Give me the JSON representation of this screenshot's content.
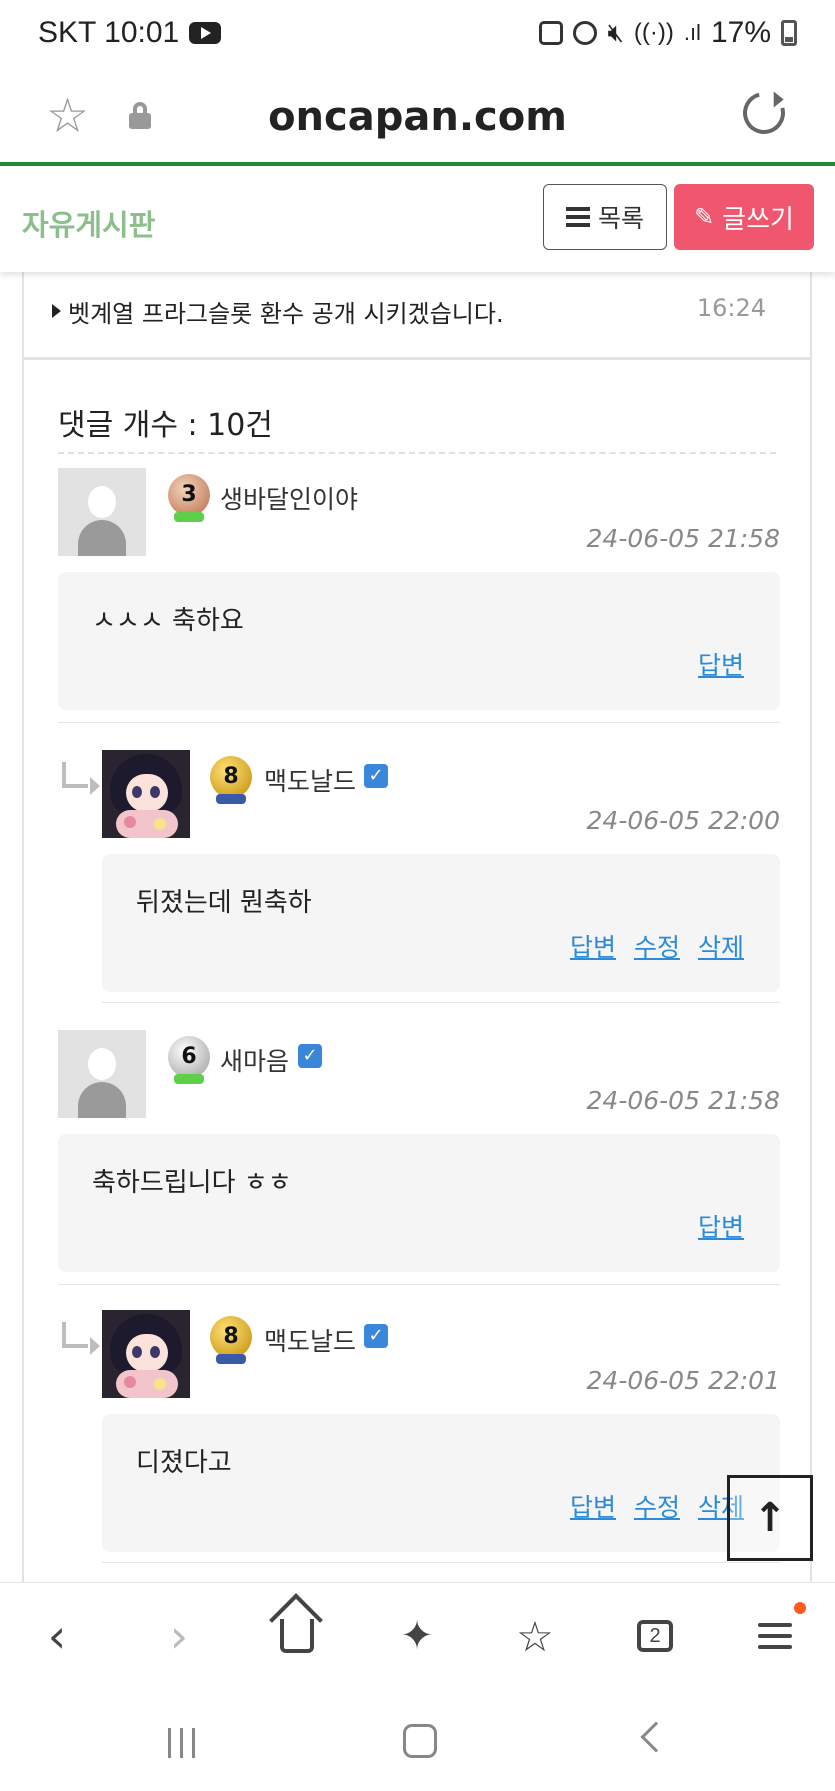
{
  "status_bar": {
    "carrier_time": "SKT 10:01",
    "battery": "17%"
  },
  "browser": {
    "url": "oncapan.com"
  },
  "board": {
    "title": "자유게시판",
    "list_button": "목록",
    "write_button": "글쓰기"
  },
  "prev_post": {
    "title": "벳계열 프라그슬롯 환수 공개 시키겠습니다.",
    "time": "16:24"
  },
  "comments_header": "댓글 개수 : 10건",
  "comments": [
    {
      "nickname": "생바달인이야",
      "level": "3",
      "verified": false,
      "is_reply": false,
      "avatar": "default-avatar",
      "time": "24-06-05 21:58",
      "text": "ㅅㅅㅅ 축하요",
      "actions": [
        "답변"
      ]
    },
    {
      "nickname": "맥도날드",
      "level": "8",
      "verified": true,
      "is_reply": true,
      "avatar": "anime-avatar",
      "time": "24-06-05 22:00",
      "text": "뒤졌는데 뭔축하",
      "actions": [
        "답변",
        "수정",
        "삭제"
      ]
    },
    {
      "nickname": "새마음",
      "level": "6",
      "verified": true,
      "is_reply": false,
      "avatar": "default-avatar",
      "time": "24-06-05 21:58",
      "text": "축하드립니다 ㅎㅎ",
      "actions": [
        "답변"
      ]
    },
    {
      "nickname": "맥도날드",
      "level": "8",
      "verified": true,
      "is_reply": true,
      "avatar": "anime-avatar",
      "time": "24-06-05 22:01",
      "text": "디졌다고",
      "actions": [
        "답변",
        "수정",
        "삭제"
      ]
    }
  ],
  "bottom_toolbar": {
    "tab_count": "2"
  },
  "colors": {
    "accent_green": "#1e8c3a",
    "board_title": "#8cbf8c",
    "write_button": "#f0566d",
    "link_blue": "#2c8ad8"
  }
}
